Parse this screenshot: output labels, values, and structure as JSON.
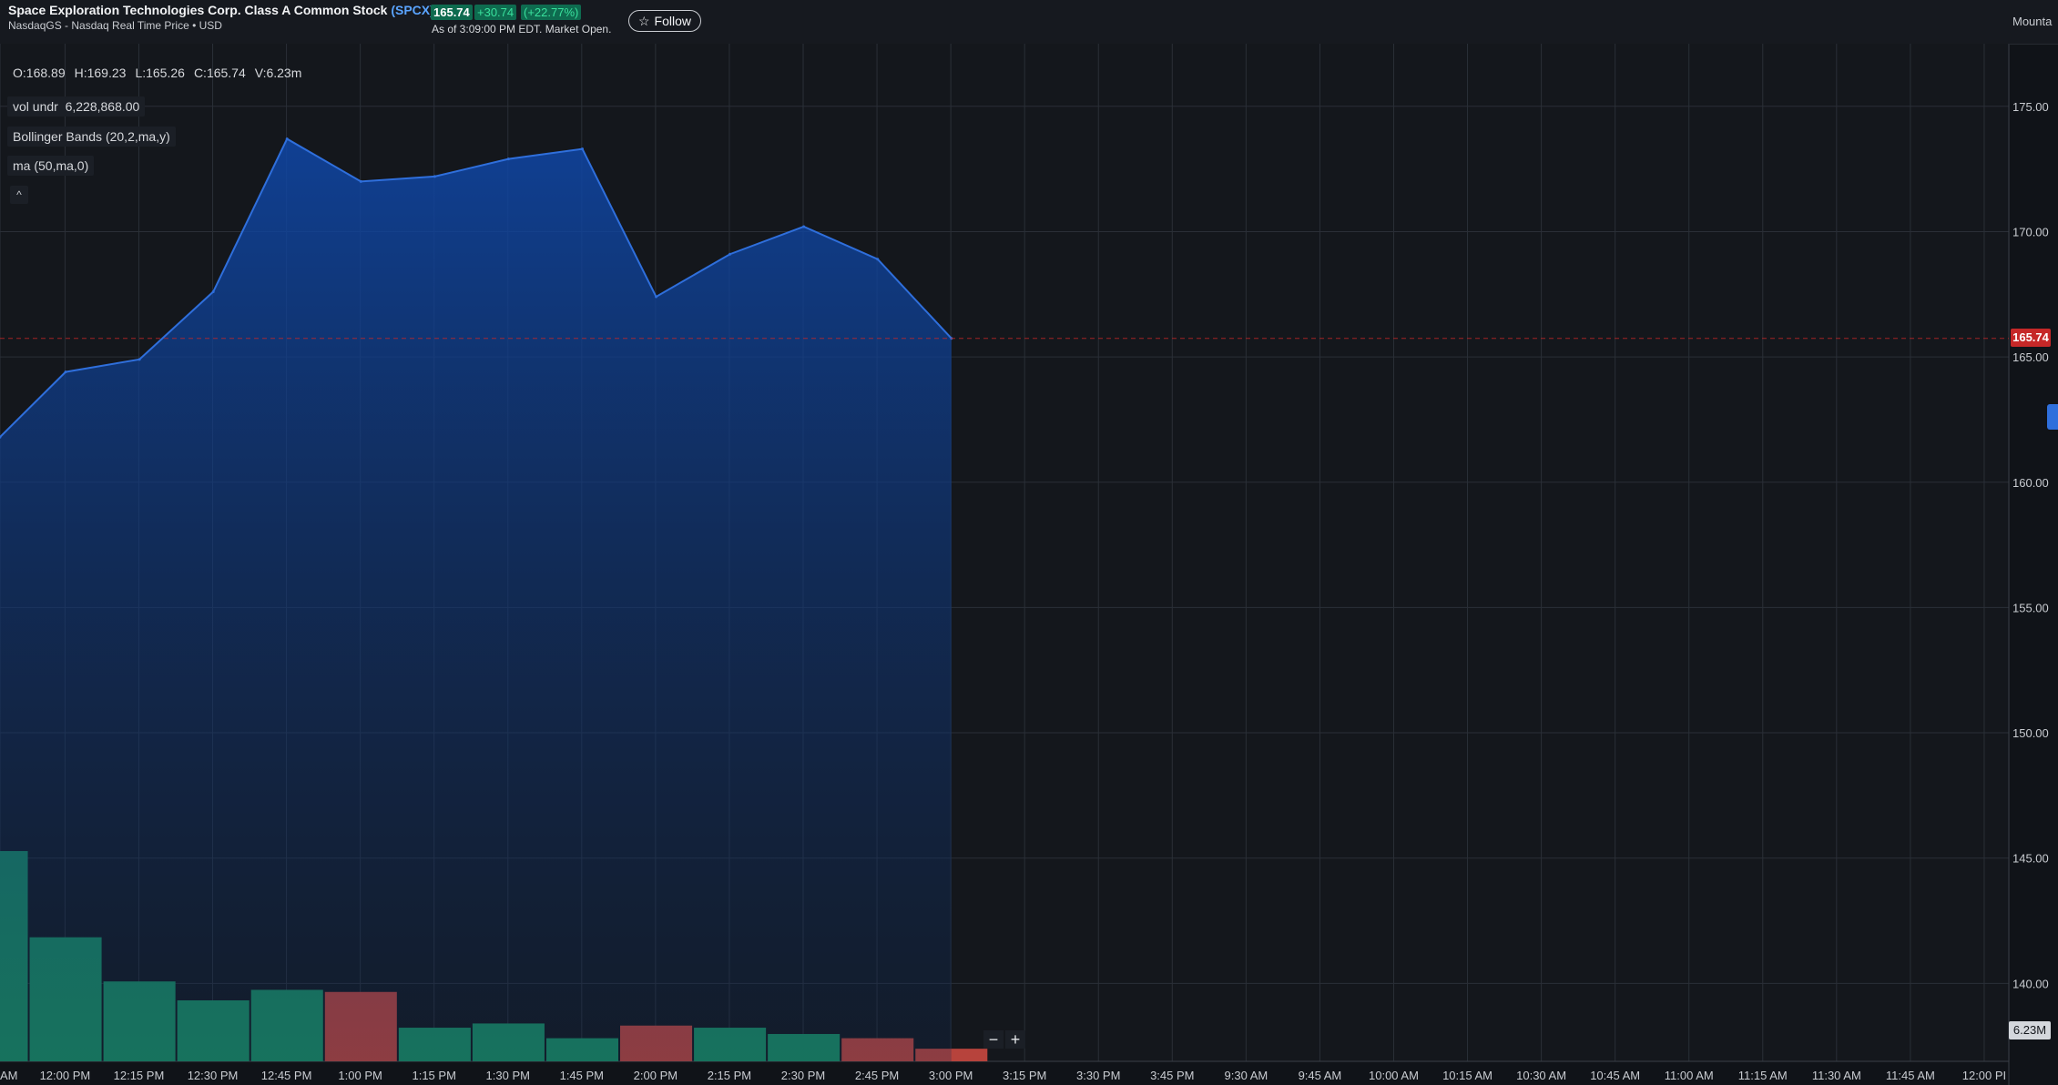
{
  "header": {
    "company_name": "Space Exploration Technologies Corp. Class A Common Stock",
    "ticker": "(SPCX)",
    "exchange_line": "NasdaqGS - Nasdaq Real Time Price • USD",
    "price": "165.74",
    "change": "+30.74",
    "change_pct": "(+22.77%)",
    "as_of": "As of 3:09:00 PM EDT. Market Open.",
    "follow_label": "Follow",
    "follow_icon": "star-outline-icon",
    "timezone_label": "Mounta"
  },
  "legend": {
    "open": "O:168.89",
    "high": "H:169.23",
    "low": "L:165.26",
    "close": "C:165.74",
    "volume": "V:6.23m",
    "vol_study": "vol undr",
    "vol_value": "6,228,868.00",
    "bollinger": "Bollinger Bands (20,2,ma,y)",
    "ma": "ma (50,ma,0)",
    "collapse_icon": "chevron-up-icon"
  },
  "tags": {
    "last_price": "165.74",
    "volume": "6.23M"
  },
  "controls": {
    "zoom_out": "−",
    "zoom_in": "+"
  },
  "colors": {
    "area_line": "#2f6fdc",
    "up_volume": "#1a8a60",
    "down_volume": "#b7433c",
    "last_price": "#c62828"
  },
  "chart_data": {
    "type": "area",
    "x_ticks": [
      "AM",
      "12:00 PM",
      "12:15 PM",
      "12:30 PM",
      "12:45 PM",
      "1:00 PM",
      "1:15 PM",
      "1:30 PM",
      "1:45 PM",
      "2:00 PM",
      "2:15 PM",
      "2:30 PM",
      "2:45 PM",
      "3:00 PM",
      "3:15 PM",
      "3:30 PM",
      "3:45 PM",
      "9:30 AM",
      "9:45 AM",
      "10:00 AM",
      "10:15 AM",
      "10:30 AM",
      "10:45 AM",
      "11:00 AM",
      "11:15 AM",
      "11:30 AM",
      "11:45 AM",
      "12:00 PI"
    ],
    "y_ticks": [
      "175.00",
      "170.00",
      "165.00",
      "160.00",
      "155.00",
      "150.00",
      "145.00",
      "140.00"
    ],
    "ylim": [
      137,
      176.5
    ],
    "price_series": {
      "x": [
        "11:45 AM",
        "12:00 PM",
        "12:15 PM",
        "12:30 PM",
        "12:45 PM",
        "1:00 PM",
        "1:15 PM",
        "1:30 PM",
        "1:45 PM",
        "2:00 PM",
        "2:15 PM",
        "2:30 PM",
        "2:45 PM",
        "3:00 PM"
      ],
      "values": [
        161.8,
        164.4,
        164.9,
        167.6,
        173.7,
        172.0,
        172.2,
        172.9,
        173.3,
        167.4,
        169.1,
        170.2,
        168.9,
        165.74
      ]
    },
    "volume_series": {
      "x": [
        "11:45 AM",
        "12:00 PM",
        "12:15 PM",
        "12:30 PM",
        "12:45 PM",
        "1:00 PM",
        "1:15 PM",
        "1:30 PM",
        "1:45 PM",
        "2:00 PM",
        "2:15 PM",
        "2:30 PM",
        "2:45 PM",
        "3:00 PM"
      ],
      "relative": [
        1.0,
        0.59,
        0.38,
        0.29,
        0.34,
        0.33,
        0.16,
        0.18,
        0.11,
        0.17,
        0.16,
        0.13,
        0.11,
        0.06
      ],
      "direction": [
        "up",
        "up",
        "up",
        "up",
        "up",
        "down",
        "up",
        "up",
        "up",
        "down",
        "up",
        "up",
        "down",
        "down"
      ]
    },
    "last_price_line": 165.74
  }
}
